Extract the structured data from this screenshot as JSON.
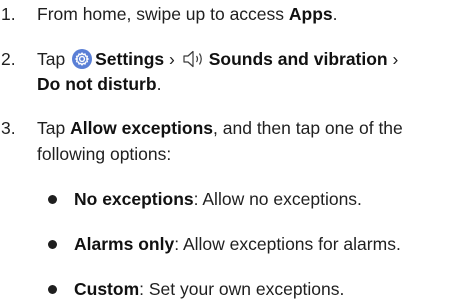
{
  "steps": [
    {
      "number": "1.",
      "text_before": "From home, swipe up to access ",
      "bold": "Apps",
      "text_after": "."
    },
    {
      "number": "2.",
      "text_tap": "Tap",
      "settings_icon": "settings-gear-icon",
      "settings_label": "Settings",
      "separator": "›",
      "sound_icon": "speaker-icon",
      "sounds_label": "Sounds and vibration",
      "dnd_label": "Do not disturb",
      "end": "."
    },
    {
      "number": "3.",
      "text_tap": "Tap ",
      "bold": "Allow exceptions",
      "text_after": ", and then tap one of the following options:"
    }
  ],
  "options": [
    {
      "label": "No exceptions",
      "description": ": Allow no exceptions."
    },
    {
      "label": "Alarms only",
      "description": ": Allow exceptions for alarms."
    },
    {
      "label": "Custom",
      "description": ": Set your own exceptions."
    }
  ],
  "colors": {
    "settings_icon_bg": "#5a7fd6",
    "text": "#1f1f1f"
  }
}
